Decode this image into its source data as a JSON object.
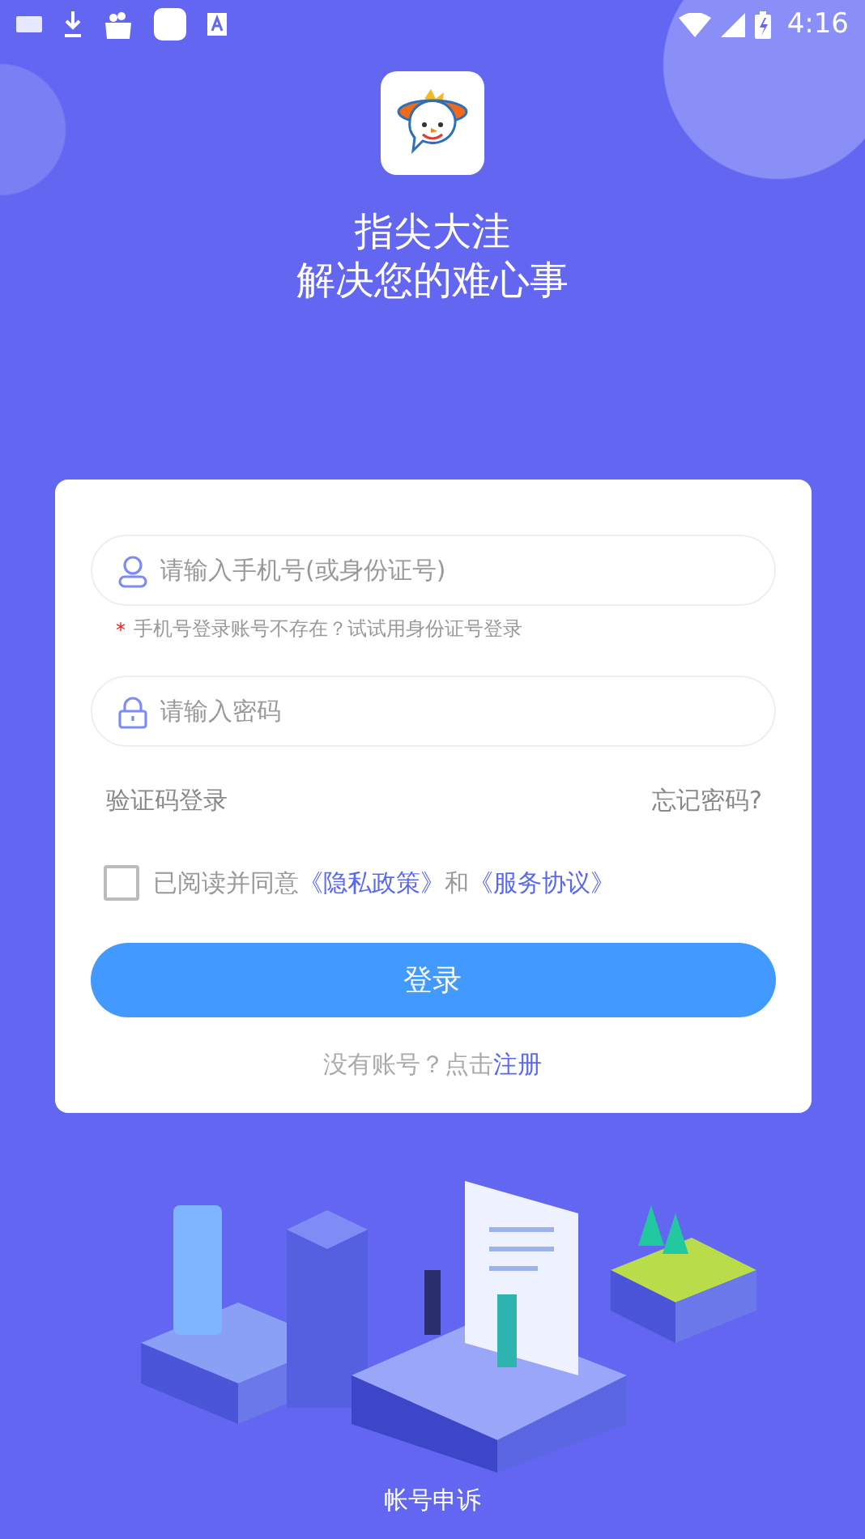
{
  "status_bar": {
    "time": "4:16"
  },
  "header": {
    "title_lines": [
      "指尖大洼",
      "解决您的难心事"
    ]
  },
  "login_form": {
    "phone_field": {
      "placeholder": "请输入手机号(或身份证号)"
    },
    "hint": {
      "mark": "*",
      "text": "手机号登录账号不存在？试试用身份证号登录"
    },
    "password_field": {
      "placeholder": "请输入密码"
    },
    "code_login_link": "验证码登录",
    "forgot_password_link": "忘记密码?",
    "agreement": {
      "checked": false,
      "parts": [
        {
          "kind": "plain",
          "text": "已阅读并同意"
        },
        {
          "kind": "link",
          "text": "《隐私政策》"
        },
        {
          "kind": "plain",
          "text": "和"
        },
        {
          "kind": "link",
          "text": "《服务协议》"
        }
      ]
    },
    "login_button": "登录",
    "register": {
      "prompt": "没有账号？点击",
      "link": "注册"
    }
  },
  "footer_link": "帐号申诉"
}
